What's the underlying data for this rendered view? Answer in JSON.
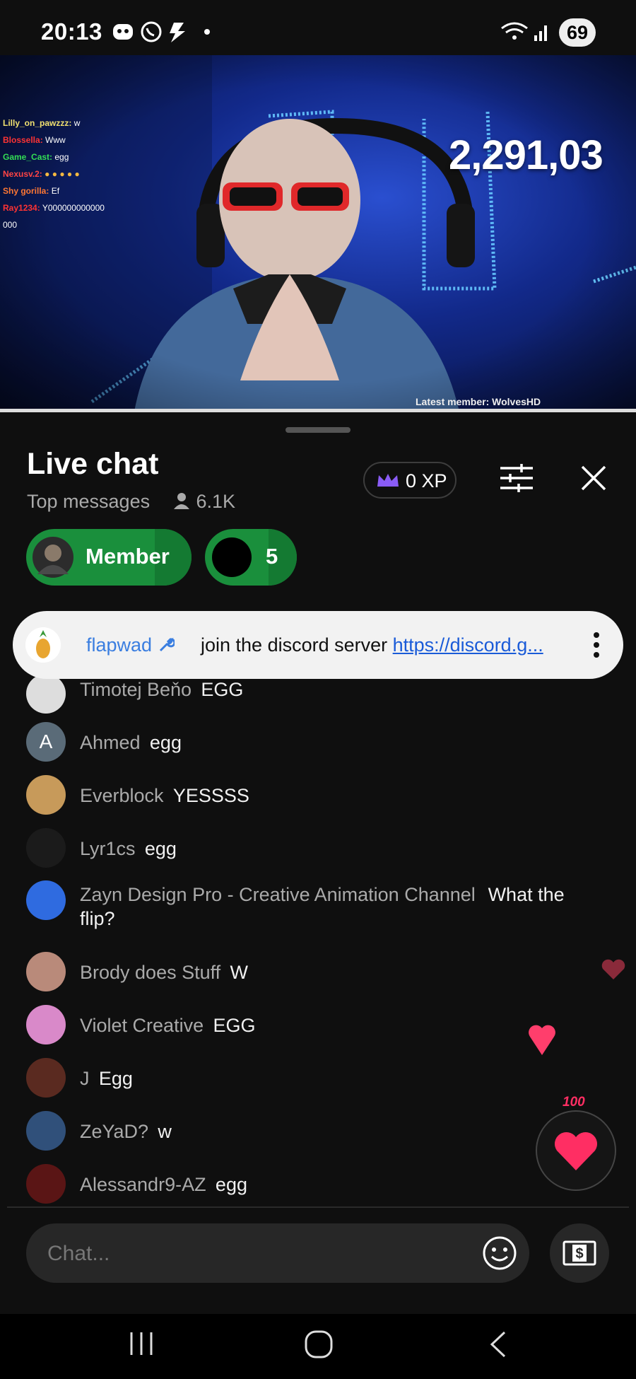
{
  "status_bar": {
    "time": "20:13",
    "battery": "69"
  },
  "video": {
    "counter": "2,291,03",
    "latest_member": "Latest member: WolvesHD",
    "overlay_chat": [
      {
        "name": "Lilly_on_pawzzz:",
        "text": "w",
        "color": "#f0e070"
      },
      {
        "name": "Blossella:",
        "text": "Www",
        "color": "#ff3333"
      },
      {
        "name": "Game_Cast:",
        "text": "egg",
        "color": "#33dd55"
      },
      {
        "name": "Nexusv.2:",
        "text": "● ● ● ● ●",
        "color": "#ff4444"
      },
      {
        "name": "Shy gorilla:",
        "text": "Ef",
        "color": "#ff7733"
      },
      {
        "name": "Ray1234:",
        "text": "Y000000000000",
        "color": "#ff3333"
      },
      {
        "name": "",
        "text": "000",
        "color": "#ffffff"
      }
    ]
  },
  "chat": {
    "title": "Live chat",
    "mode": "Top messages",
    "viewers": "6.1K",
    "xp": "0 XP",
    "chips": {
      "member": "Member",
      "count": "5"
    },
    "pinned": {
      "author": "flapwad",
      "text": "join the discord server ",
      "link": "https://discord.g..."
    },
    "messages": [
      {
        "author": "Timotej Beňo",
        "text": "EGG"
      },
      {
        "author": "Ahmed",
        "text": "egg",
        "initial": "A"
      },
      {
        "author": "Everblock",
        "text": "YESSSS"
      },
      {
        "author": "Lyr1cs",
        "text": "egg"
      },
      {
        "author": "Zayn Design Pro - Creative Animation Channel",
        "text": "What the",
        "text2": "flip?"
      },
      {
        "author": "Brody does Stuff",
        "text": "W"
      },
      {
        "author": "Violet Creative",
        "text": "EGG"
      },
      {
        "author": "J",
        "text": "Egg"
      },
      {
        "author": "ZeYaD?",
        "text": "w"
      },
      {
        "author": "Alessandr9-AZ",
        "text": "egg"
      }
    ],
    "heart_count": "100",
    "input_placeholder": "Chat..."
  },
  "colors": {
    "member_green": "#1a8f3c",
    "heart": "#ff2e63",
    "link": "#1a5bd8"
  }
}
